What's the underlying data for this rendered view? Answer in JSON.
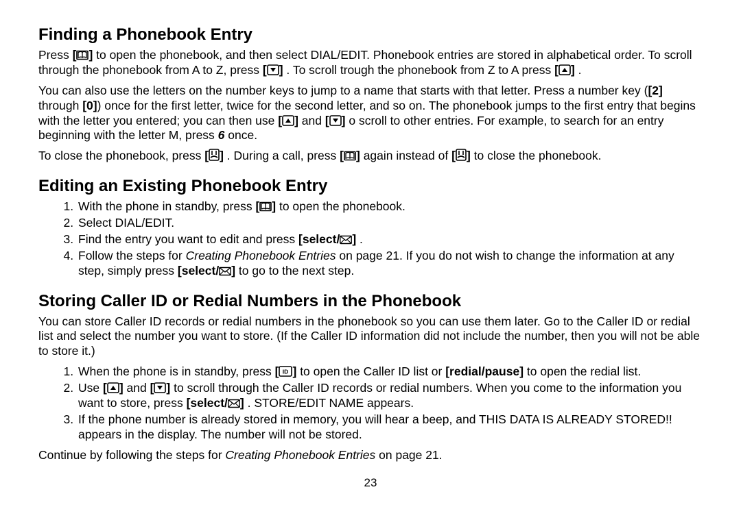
{
  "section1": {
    "title": "Finding a Phonebook Entry",
    "p1_a": "Press ",
    "p1_b": " to open the phonebook, and then select DIAL/EDIT. Phonebook entries are stored in alphabetical order. To scroll through the phonebook from A to Z, press ",
    "p1_c": ". To scroll trough the phonebook from Z to A press ",
    "p1_d": ".",
    "p2_a": "You can also use the letters on the number keys to jump to a name that starts with that letter. Press a number key (",
    "p2_b": " through ",
    "p2_c": ") once for the first letter, twice for the second letter, and so on. The phonebook jumps to the first entry that begins with the letter you entered; you can then use ",
    "p2_d": " and ",
    "p2_e": " o scroll to other entries. For example, to search for an entry beginning with the letter M, press ",
    "p2_six": "6",
    "p2_f": " once.",
    "key2": "[2]",
    "key0": "[0]",
    "p3_a": "To close the phonebook, press ",
    "p3_b": ". During a call, press ",
    "p3_c": " again instead of ",
    "p3_d": " to close the phonebook."
  },
  "section2": {
    "title": "Editing an Existing Phonebook Entry",
    "li1_a": "With the phone in standby, press ",
    "li1_b": "  to open the phonebook.",
    "li2": "Select DIAL/EDIT.",
    "li3_a": "Find the entry you want to edit and press ",
    "li3_b": ".",
    "li4_a": "Follow the steps for ",
    "li4_link": "Creating Phonebook Entries",
    "li4_b": " on page 21. If you do not wish to change the information at any step, simply press ",
    "li4_c": " to go to the next step.",
    "select_label": "[select/",
    "select_close": "]"
  },
  "section3": {
    "title": "Storing Caller ID or Redial Numbers in the Phonebook",
    "p1": "You can store Caller ID records or redial numbers in the phonebook so you can use them later. Go to the Caller ID or redial list and select the number you want to store. (If the Caller ID information did not include the number, then you will not be able to store it.)",
    "li1_a": "When the phone is in standby, press ",
    "li1_b": " to open the Caller ID list or ",
    "redial": "[redial/pause]",
    "li1_c": " to open the redial list.",
    "li2_a": "Use ",
    "li2_b": " and ",
    "li2_c": "  to scroll through the Caller ID records or redial numbers. When you come to the information you want to store, press ",
    "li2_d": ". STORE/EDIT NAME appears.",
    "li3": "If the phone number is already stored in memory, you will hear a beep, and THIS DATA IS ALREADY STORED!! appears in the display. The number will not be stored.",
    "p2_a": "Continue by following the steps for ",
    "p2_link": "Creating Phonebook Entries",
    "p2_b": " on page 21."
  },
  "page_number": "23",
  "icons": {
    "book": "book-icon",
    "down": "down-triangle-icon",
    "up": "up-triangle-icon",
    "end": "end-call-icon",
    "envelope": "envelope-icon",
    "cid": "caller-id-icon"
  }
}
